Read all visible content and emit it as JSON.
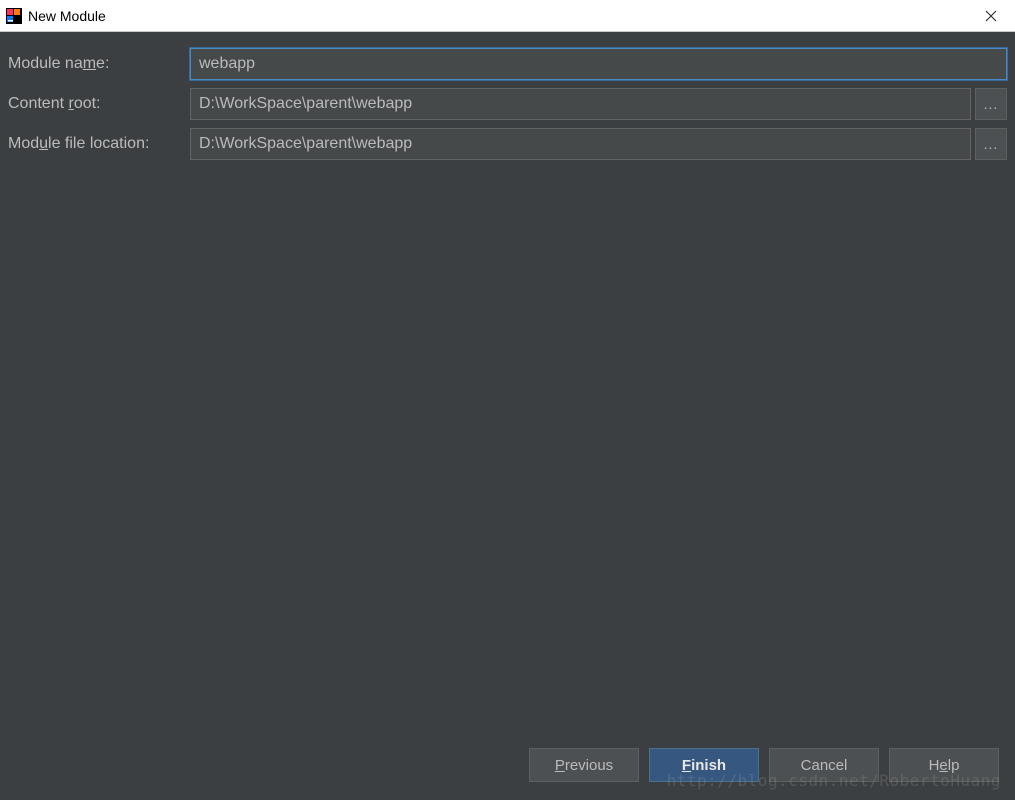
{
  "window": {
    "title": "New Module"
  },
  "form": {
    "module_name": {
      "label_pre": "Module na",
      "label_ul": "m",
      "label_post": "e:",
      "value": "webapp"
    },
    "content_root": {
      "label_pre": "Content ",
      "label_ul": "r",
      "label_post": "oot:",
      "value": "D:\\WorkSpace\\parent\\webapp"
    },
    "module_file_location": {
      "label_pre": "Mod",
      "label_ul": "u",
      "label_post": "le file location:",
      "value": "D:\\WorkSpace\\parent\\webapp"
    },
    "browse_label": "..."
  },
  "buttons": {
    "previous_ul": "P",
    "previous_post": "revious",
    "finish_ul": "F",
    "finish_post": "inish",
    "cancel": "Cancel",
    "help_pre": "H",
    "help_ul": "e",
    "help_post": "lp"
  },
  "watermark": "http://blog.csdn.net/RobertoHuang"
}
